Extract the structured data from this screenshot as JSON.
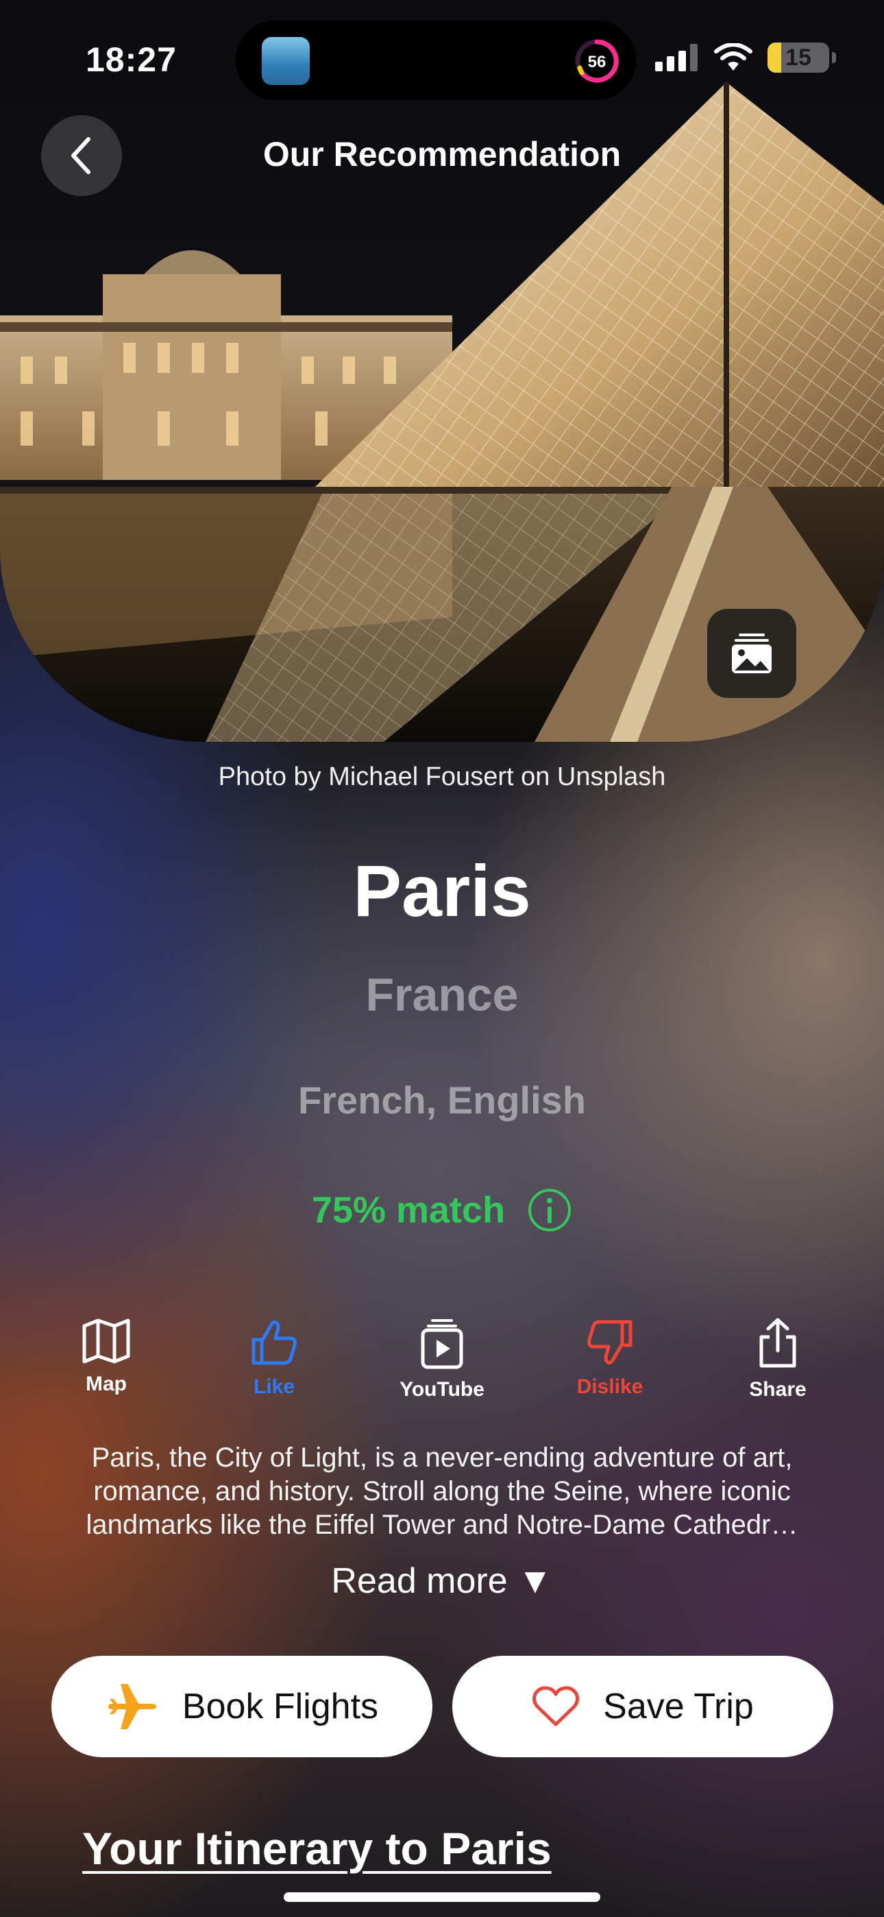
{
  "status_bar": {
    "time": "18:27",
    "activity_ring_value": "56",
    "battery_level": "15"
  },
  "nav": {
    "title": "Our Recommendation"
  },
  "photo": {
    "credit": "Photo by Michael Fousert on Unsplash"
  },
  "destination": {
    "city": "Paris",
    "country": "France",
    "languages": "French, English",
    "match": "75% match"
  },
  "actions": [
    {
      "label": "Map",
      "icon": "map-icon",
      "color": "#ffffff"
    },
    {
      "label": "Like",
      "icon": "thumbs-up-icon",
      "color": "#2d7cf6"
    },
    {
      "label": "YouTube",
      "icon": "youtube-icon",
      "color": "#ffffff"
    },
    {
      "label": "Dislike",
      "icon": "thumbs-down-icon",
      "color": "#f0453a"
    },
    {
      "label": "Share",
      "icon": "share-icon",
      "color": "#ffffff"
    }
  ],
  "description": "Paris, the City of Light, is a never-ending adventure of art, romance, and history. Stroll along the Seine, where iconic landmarks like the Eiffel Tower and Notre-Dame Cathedr…",
  "read_more": "Read more ▼",
  "buttons": {
    "book_flights": "Book Flights",
    "save_trip": "Save Trip"
  },
  "itinerary_title": "Your Itinerary to Paris",
  "colors": {
    "match_green": "#34c759",
    "like_blue": "#2d7cf6",
    "dislike_red": "#f0453a",
    "plane_orange": "#f7a21b",
    "heart_red": "#e8473d"
  }
}
